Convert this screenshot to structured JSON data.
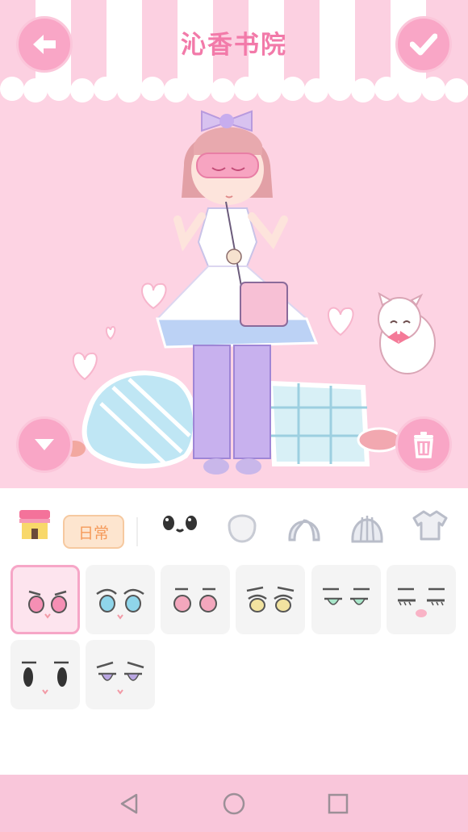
{
  "header": {
    "title": "沁香书院"
  },
  "icons": {
    "back": "arrow-left-icon",
    "confirm": "checkmark-icon",
    "collapse": "chevron-down-icon",
    "delete": "trash-icon"
  },
  "categories": {
    "shop": "shop-icon",
    "tag_label": "日常",
    "items": [
      "eyes-icon",
      "face-icon",
      "hair-front-icon",
      "hair-back-icon",
      "shirt-icon"
    ]
  },
  "eye_options": {
    "selected_index": 0,
    "colors": [
      "#f58fb4",
      "#8fd5ea",
      "#f3a7bd",
      "#f2e3a0",
      "#a8e6c9",
      "#555555",
      "#333333",
      "#b9a6e2"
    ]
  },
  "colors": {
    "accent_pink": "#f9a6c6",
    "stage_bg": "#fdd3e3",
    "tag_bg": "#fde5cf",
    "tag_text": "#f59a5a",
    "nav_bg": "#f9c6da"
  }
}
